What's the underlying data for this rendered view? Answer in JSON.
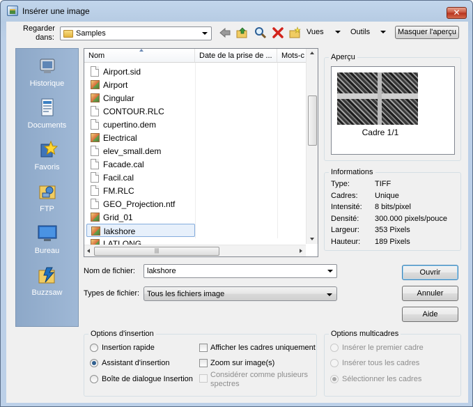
{
  "window": {
    "title": "Insérer une image",
    "close_label": "✕"
  },
  "lookin": {
    "label_line1": "Regarder",
    "label_line2": "dans:",
    "value": "Samples"
  },
  "toolbar": {
    "views_label": "Vues",
    "tools_label": "Outils",
    "hide_preview_label": "Masquer l'aperçu"
  },
  "places": [
    {
      "label": "Historique",
      "icon": "history-icon"
    },
    {
      "label": "Documents",
      "icon": "documents-icon"
    },
    {
      "label": "Favoris",
      "icon": "favorites-icon"
    },
    {
      "label": "FTP",
      "icon": "ftp-icon"
    },
    {
      "label": "Bureau",
      "icon": "desktop-icon"
    },
    {
      "label": "Buzzsaw",
      "icon": "buzzsaw-icon"
    }
  ],
  "filelist": {
    "columns": [
      "Nom",
      "Date de la prise de ...",
      "Mots-c"
    ],
    "files": [
      {
        "name": "Airport.sid",
        "type": "doc"
      },
      {
        "name": "Airport",
        "type": "img"
      },
      {
        "name": "Cingular",
        "type": "img"
      },
      {
        "name": "CONTOUR.RLC",
        "type": "doc"
      },
      {
        "name": "cupertino.dem",
        "type": "doc"
      },
      {
        "name": "Electrical",
        "type": "img"
      },
      {
        "name": "elev_small.dem",
        "type": "doc"
      },
      {
        "name": "Facade.cal",
        "type": "doc"
      },
      {
        "name": "Facil.cal",
        "type": "doc"
      },
      {
        "name": "FM.RLC",
        "type": "doc"
      },
      {
        "name": "GEO_Projection.ntf",
        "type": "doc"
      },
      {
        "name": "Grid_01",
        "type": "img"
      },
      {
        "name": "lakshore",
        "type": "img",
        "selected": true
      },
      {
        "name": "LATLONG",
        "type": "img"
      }
    ]
  },
  "preview": {
    "title": "Aperçu",
    "caption": "Cadre 1/1"
  },
  "info": {
    "title": "Informations",
    "rows": [
      {
        "key": "Type:",
        "value": "TIFF"
      },
      {
        "key": "Cadres:",
        "value": "Unique"
      },
      {
        "key": "Intensité:",
        "value": "8 bits/pixel"
      },
      {
        "key": "Densité:",
        "value": "300.000 pixels/pouce"
      },
      {
        "key": "Largeur:",
        "value": "353 Pixels"
      },
      {
        "key": "Hauteur:",
        "value": "189 Pixels"
      }
    ]
  },
  "filename": {
    "label": "Nom de fichier:",
    "value": "lakshore"
  },
  "filetype": {
    "label": "Types de fichier:",
    "value": "Tous les fichiers image"
  },
  "buttons": {
    "open": "Ouvrir",
    "cancel": "Annuler",
    "help": "Aide"
  },
  "insert_options": {
    "title": "Options d'insertion",
    "radios": [
      {
        "label": "Insertion rapide",
        "checked": false
      },
      {
        "label": "Assistant d'insertion",
        "checked": true
      },
      {
        "label": "Boîte de dialogue Insertion",
        "checked": false
      }
    ],
    "checks": [
      {
        "label": "Afficher les cadres uniquement",
        "enabled": true
      },
      {
        "label": "Zoom sur image(s)",
        "enabled": true
      },
      {
        "label_line1": "Considérer comme plusieurs",
        "label_line2": "spectres",
        "enabled": false
      }
    ]
  },
  "multiframe_options": {
    "title": "Options multicadres",
    "radios": [
      {
        "label": "Insérer le premier cadre",
        "checked": false
      },
      {
        "label": "Insérer tous les cadres",
        "checked": false
      },
      {
        "label": "Sélectionner les cadres",
        "checked": true
      }
    ]
  }
}
